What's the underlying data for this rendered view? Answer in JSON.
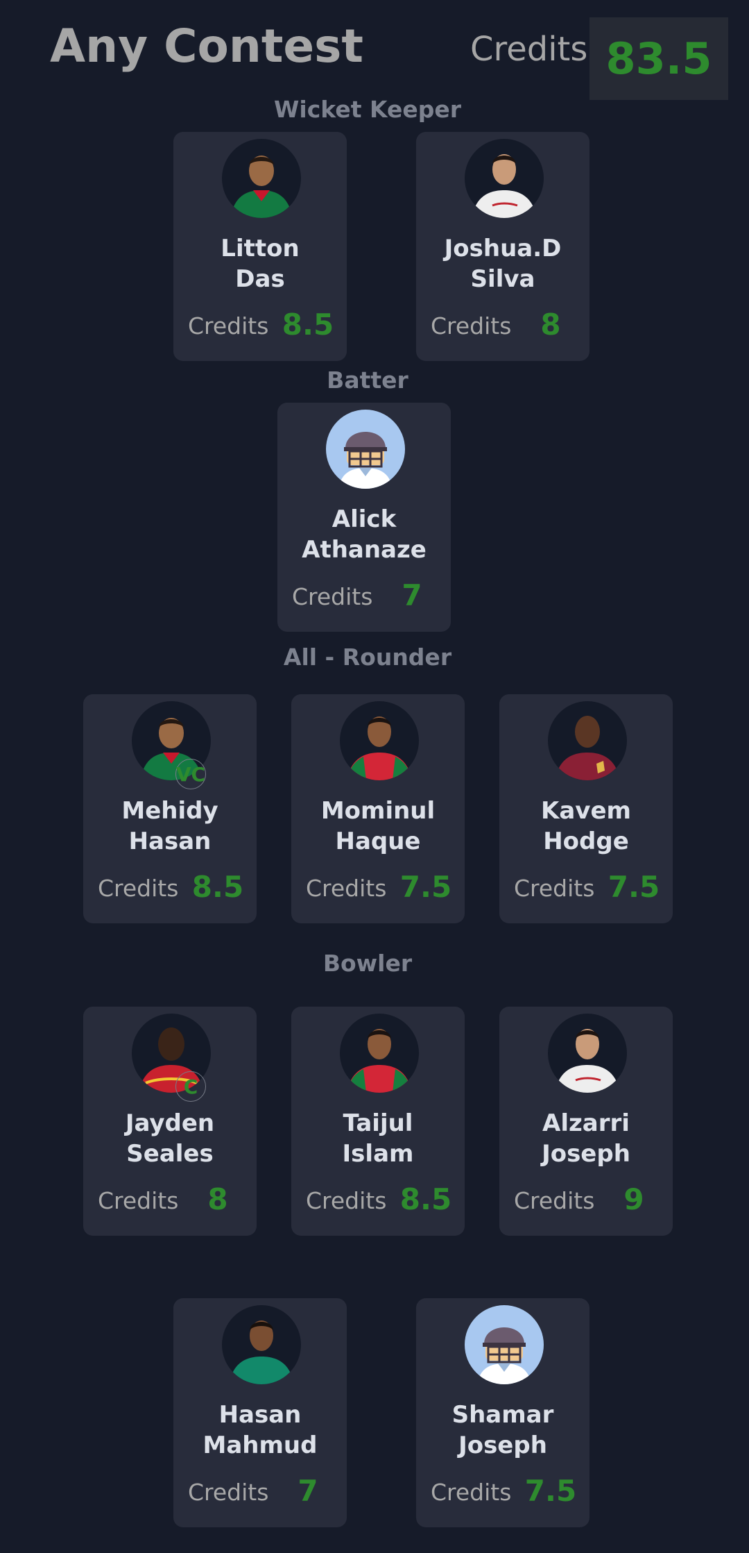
{
  "header": {
    "title": "Any Contest",
    "credits_label": "Credits",
    "credits_value": "83.5"
  },
  "colors": {
    "background": "#161b29",
    "card": "#282c3b",
    "credits_green": "#2e8b2e",
    "section_title": "#7d828f"
  },
  "sections": {
    "wicket_keeper": "Wicket Keeper",
    "batter": "Batter",
    "all_rounder": "All - Rounder",
    "bowler": "Bowler"
  },
  "players": [
    {
      "first": "Litton",
      "last": "Das",
      "credits_label": "Credits",
      "credits": "8.5",
      "avatar": "photo-green-jersey"
    },
    {
      "first": "Joshua.D",
      "last": "Silva",
      "credits_label": "Credits",
      "credits": "8",
      "avatar": "photo-white-jersey"
    },
    {
      "first": "Alick",
      "last": "Athanaze",
      "credits_label": "Credits",
      "credits": "7",
      "avatar": "default-helmet-icon"
    },
    {
      "first": "Mehidy",
      "last": "Hasan",
      "credits_label": "Credits",
      "credits": "8.5",
      "avatar": "photo-green-jersey",
      "badge": "VC"
    },
    {
      "first": "Mominul",
      "last": "Haque",
      "credits_label": "Credits",
      "credits": "7.5",
      "avatar": "photo-red-green-jersey"
    },
    {
      "first": "Kavem",
      "last": "Hodge",
      "credits_label": "Credits",
      "credits": "7.5",
      "avatar": "photo-maroon-jersey"
    },
    {
      "first": "Jayden",
      "last": "Seales",
      "credits_label": "Credits",
      "credits": "8",
      "avatar": "photo-red-jersey",
      "badge": "C"
    },
    {
      "first": "Taijul",
      "last": "Islam",
      "credits_label": "Credits",
      "credits": "8.5",
      "avatar": "photo-red-green-jersey"
    },
    {
      "first": "Alzarri",
      "last": "Joseph",
      "credits_label": "Credits",
      "credits": "9",
      "avatar": "photo-white-jersey"
    },
    {
      "first": "Hasan",
      "last": "Mahmud",
      "credits_label": "Credits",
      "credits": "7",
      "avatar": "photo-teal-jersey"
    },
    {
      "first": "Shamar",
      "last": "Joseph",
      "credits_label": "Credits",
      "credits": "7.5",
      "avatar": "default-helmet-icon"
    }
  ]
}
